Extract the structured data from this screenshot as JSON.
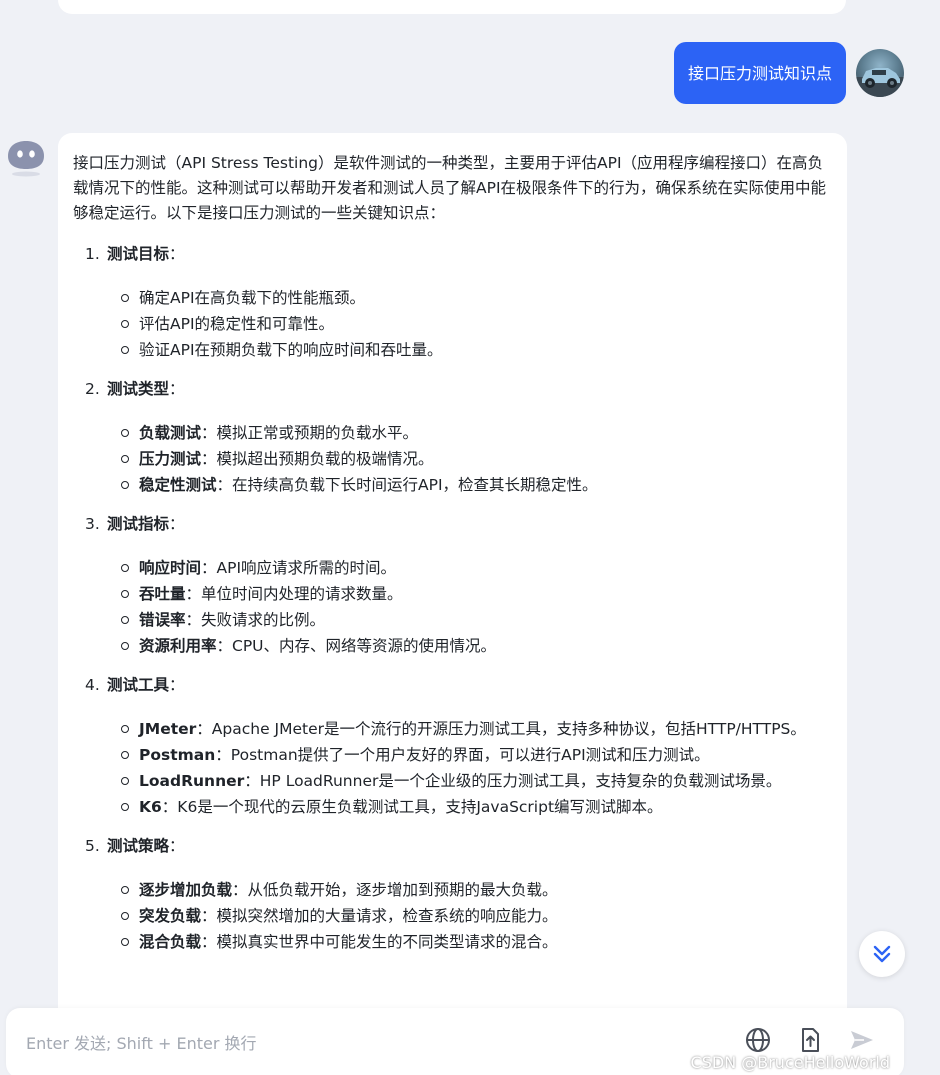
{
  "user_message": "接口压力测试知识点",
  "assistant": {
    "intro": "接口压力测试（API Stress Testing）是软件测试的一种类型，主要用于评估API（应用程序编程接口）在高负载情况下的性能。这种测试可以帮助开发者和测试人员了解API在极限条件下的行为，确保系统在实际使用中能够稳定运行。以下是接口压力测试的一些关键知识点：",
    "sections": [
      {
        "number": "1.",
        "title": "测试目标",
        "colon": "：",
        "items": [
          {
            "term": "",
            "text": "确定API在高负载下的性能瓶颈。"
          },
          {
            "term": "",
            "text": "评估API的稳定性和可靠性。"
          },
          {
            "term": "",
            "text": "验证API在预期负载下的响应时间和吞吐量。"
          }
        ]
      },
      {
        "number": "2.",
        "title": "测试类型",
        "colon": "：",
        "items": [
          {
            "term": "负载测试",
            "text": "：模拟正常或预期的负载水平。"
          },
          {
            "term": "压力测试",
            "text": "：模拟超出预期负载的极端情况。"
          },
          {
            "term": "稳定性测试",
            "text": "：在持续高负载下长时间运行API，检查其长期稳定性。"
          }
        ]
      },
      {
        "number": "3.",
        "title": "测试指标",
        "colon": "：",
        "items": [
          {
            "term": "响应时间",
            "text": "：API响应请求所需的时间。"
          },
          {
            "term": "吞吐量",
            "text": "：单位时间内处理的请求数量。"
          },
          {
            "term": "错误率",
            "text": "：失败请求的比例。"
          },
          {
            "term": "资源利用率",
            "text": "：CPU、内存、网络等资源的使用情况。"
          }
        ]
      },
      {
        "number": "4.",
        "title": "测试工具",
        "colon": "：",
        "items": [
          {
            "term": "JMeter",
            "text": "：Apache JMeter是一个流行的开源压力测试工具，支持多种协议，包括HTTP/HTTPS。"
          },
          {
            "term": "Postman",
            "text": "：Postman提供了一个用户友好的界面，可以进行API测试和压力测试。"
          },
          {
            "term": "LoadRunner",
            "text": "：HP LoadRunner是一个企业级的压力测试工具，支持复杂的负载测试场景。"
          },
          {
            "term": "K6",
            "text": "：K6是一个现代的云原生负载测试工具，支持JavaScript编写测试脚本。"
          }
        ]
      },
      {
        "number": "5.",
        "title": "测试策略",
        "colon": "：",
        "items": [
          {
            "term": "逐步增加负载",
            "text": "：从低负载开始，逐步增加到预期的最大负载。"
          },
          {
            "term": "突发负载",
            "text": "：模拟突然增加的大量请求，检查系统的响应能力。"
          },
          {
            "term": "混合负载",
            "text": "：模拟真实世界中可能发生的不同类型请求的混合。"
          }
        ]
      }
    ]
  },
  "input": {
    "placeholder": "Enter 发送; Shift + Enter 换行",
    "value": ""
  },
  "icons": {
    "globe": "globe-icon",
    "upload": "file-upload-icon",
    "send": "send-icon",
    "scroll": "double-chevron-down-icon"
  },
  "colors": {
    "accent": "#2c63f5",
    "background": "#eff1f6",
    "card": "#ffffff"
  },
  "watermark": "CSDN @BruceHelloWorld"
}
